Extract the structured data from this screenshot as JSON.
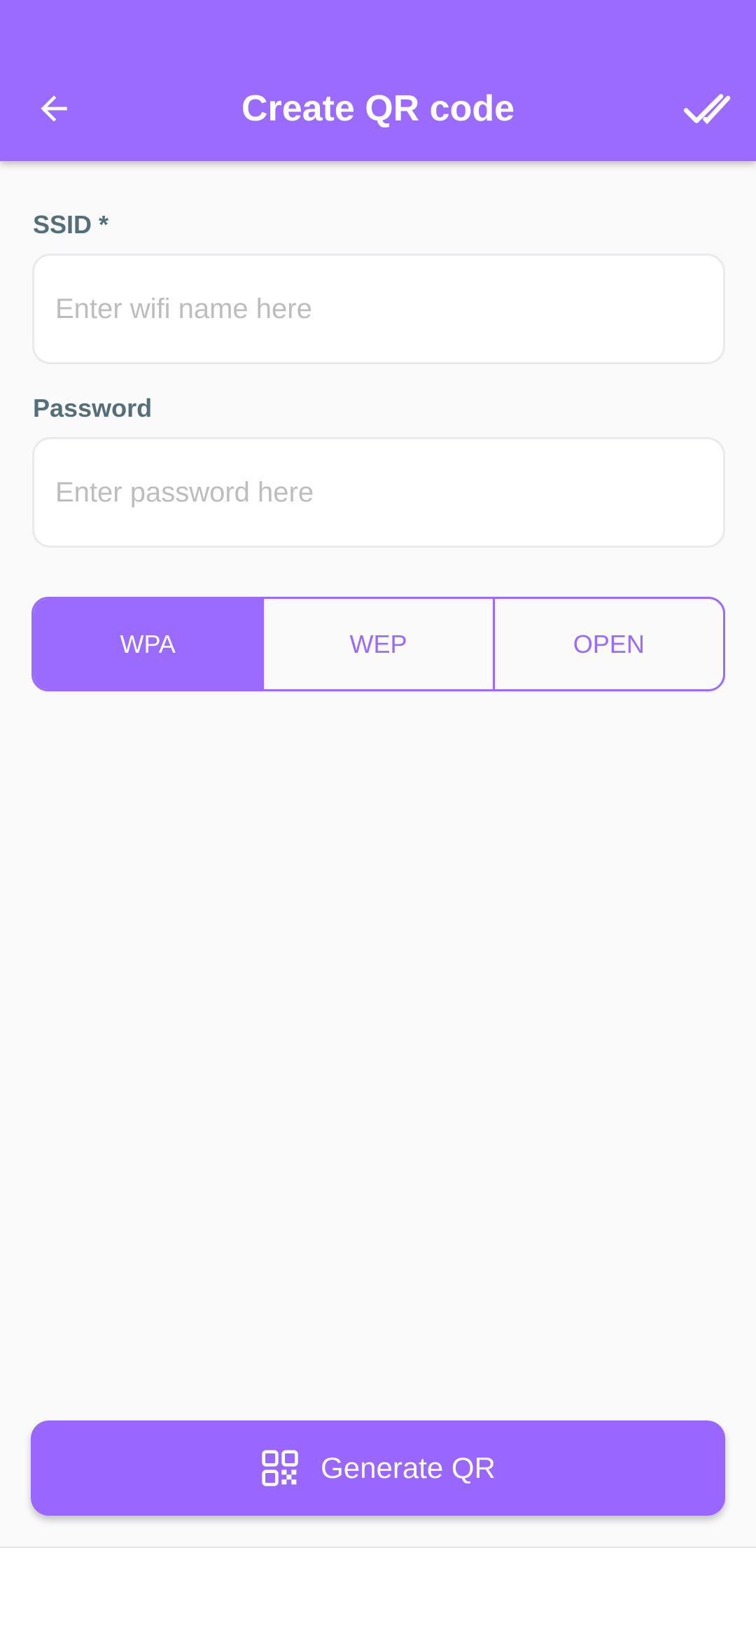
{
  "app_bar": {
    "title": "Create QR code",
    "back_icon": "arrow-left-icon",
    "done_icon": "double-check-icon",
    "background_color": "#9b6bff"
  },
  "form": {
    "ssid": {
      "label": "SSID *",
      "placeholder": "Enter wifi name here",
      "value": ""
    },
    "password": {
      "label": "Password",
      "placeholder": "Enter password here",
      "value": ""
    },
    "security_options": [
      "WPA",
      "WEP",
      "OPEN"
    ],
    "selected_security": "WPA"
  },
  "generate_button": {
    "label": "Generate QR",
    "icon": "qr-code-icon"
  },
  "accent_color": "#9b6bff"
}
